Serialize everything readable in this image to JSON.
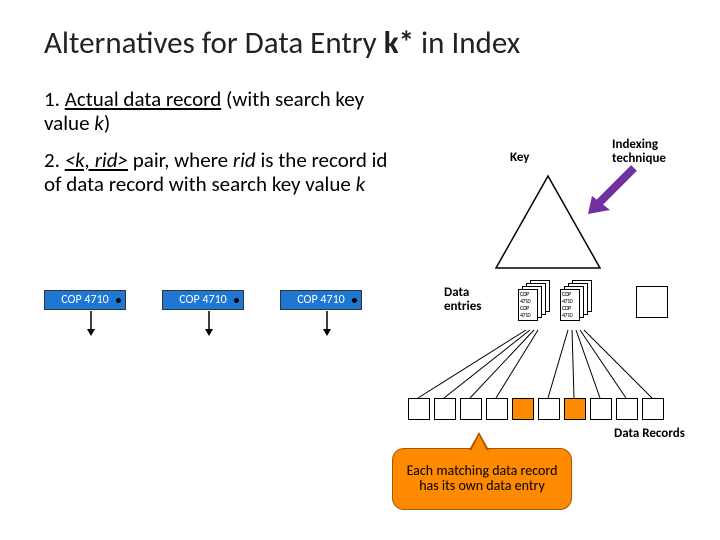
{
  "title": {
    "pre": "Alternatives for Data Entry ",
    "kstar": "k*",
    "post": " in Index"
  },
  "bullet1": {
    "num": "1. ",
    "u": "Actual data record",
    "mid": " (with search key value ",
    "k": "k",
    "end": ")"
  },
  "bullet2": {
    "num": "2. ",
    "pair": "<k, rid>",
    "mid1": " pair, where ",
    "rid": "rid",
    "mid2": " is the record id of data record with search key value ",
    "k": "k"
  },
  "tags": [
    "COP 4710",
    "COP 4710",
    "COP 4710"
  ],
  "key_label": "Key",
  "idx_label_l1": "Indexing",
  "idx_label_l2": "technique",
  "de_label_l1": "Data",
  "de_label_l2": "entries",
  "dr_label": "Data Records",
  "callout": "Each matching data record has its own data entry"
}
